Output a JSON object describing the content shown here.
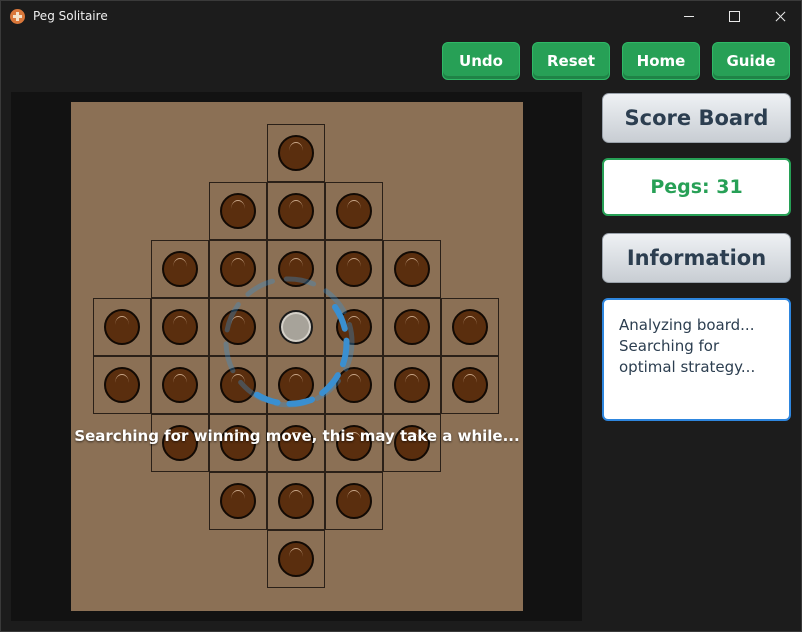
{
  "window": {
    "title": "Peg Solitaire"
  },
  "toolbar": {
    "undo": "Undo",
    "reset": "Reset",
    "home": "Home",
    "guide": "Guide"
  },
  "sidebar": {
    "scoreboard_label": "Score Board",
    "pegs_text": "Pegs: 31",
    "information_label": "Information",
    "info_text": "Analyzing board...\nSearching for\noptimal strategy..."
  },
  "board": {
    "layout": "diamond",
    "rows": [
      {
        "row": 0,
        "cols": [
          3
        ]
      },
      {
        "row": 1,
        "cols": [
          2,
          3,
          4
        ]
      },
      {
        "row": 2,
        "cols": [
          1,
          2,
          3,
          4,
          5
        ]
      },
      {
        "row": 3,
        "cols": [
          0,
          1,
          2,
          3,
          4,
          5,
          6
        ]
      },
      {
        "row": 4,
        "cols": [
          0,
          1,
          2,
          3,
          4,
          5,
          6
        ]
      },
      {
        "row": 5,
        "cols": [
          1,
          2,
          3,
          4,
          5
        ]
      },
      {
        "row": 6,
        "cols": [
          2,
          3,
          4
        ]
      },
      {
        "row": 7,
        "cols": [
          3
        ]
      }
    ],
    "empty_holes": [
      {
        "row": 3,
        "col": 3
      }
    ],
    "status_message": "Searching for winning move, this may take a while..."
  },
  "colors": {
    "board_bg": "#8b7055",
    "peg": "#5a2e0e",
    "action_button": "#27a056",
    "info_border": "#2e86de",
    "spinner": "#3a8fd0"
  }
}
